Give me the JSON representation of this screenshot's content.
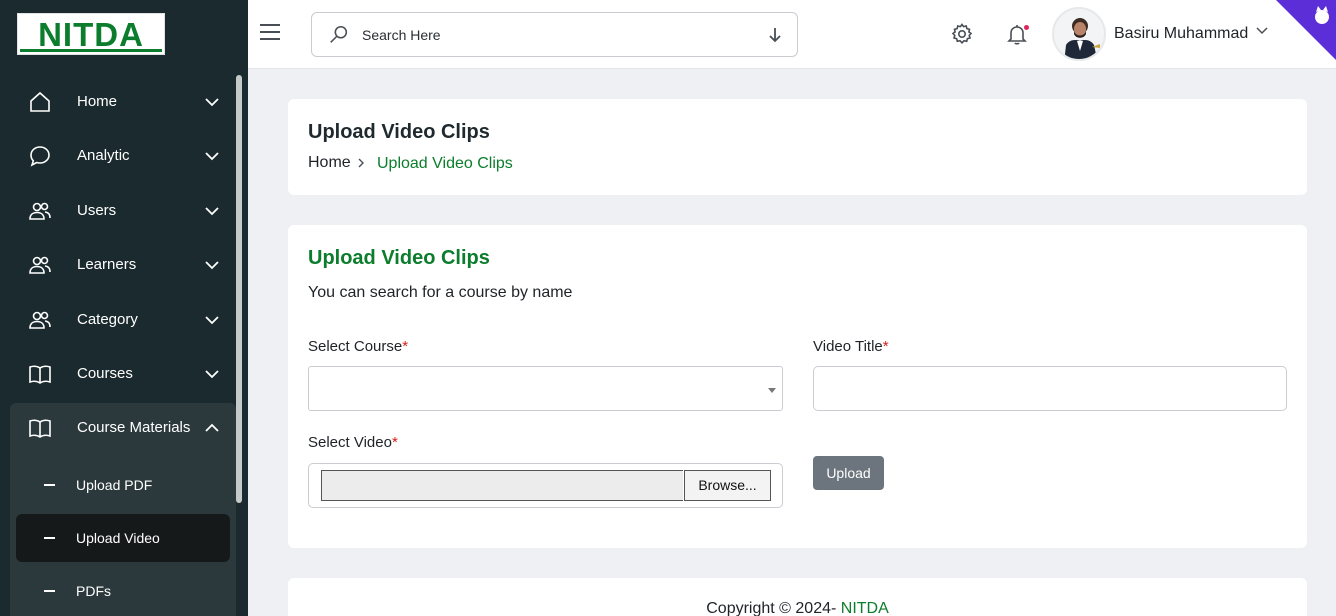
{
  "logo": {
    "text": "NITDA"
  },
  "sidebar": {
    "items": [
      {
        "label": "Home",
        "icon": "home-icon"
      },
      {
        "label": "Analytic",
        "icon": "chat-bubble-icon"
      },
      {
        "label": "Users",
        "icon": "users-icon"
      },
      {
        "label": "Learners",
        "icon": "users-icon"
      },
      {
        "label": "Category",
        "icon": "users-icon"
      },
      {
        "label": "Courses",
        "icon": "book-icon"
      },
      {
        "label": "Course Materials",
        "icon": "book-icon",
        "expanded": true
      }
    ],
    "subitems": [
      {
        "label": "Upload PDF"
      },
      {
        "label": "Upload Video",
        "active": true
      },
      {
        "label": "PDFs"
      }
    ]
  },
  "header": {
    "search_placeholder": "Search Here",
    "user_name": "Basiru Muhammad",
    "notification_dot_color": "#e0245e"
  },
  "page": {
    "title": "Upload Video Clips",
    "breadcrumb_home": "Home",
    "breadcrumb_current": "Upload Video Clips"
  },
  "form": {
    "title": "Upload Video Clips",
    "subtitle": "You can search for a course by name",
    "course_label": "Select Course",
    "title_label": "Video Title",
    "video_label": "Select Video",
    "required_mark": "*",
    "browse_label": "Browse...",
    "upload_label": "Upload",
    "course_value": "",
    "title_value": ""
  },
  "footer": {
    "copyright_prefix": "Copyright © 2024-",
    "brand": "NITDA"
  },
  "colors": {
    "accent": "#0b7d2c",
    "sidebar_bg": "#1b2a2e",
    "button_gray": "#6c757d"
  }
}
